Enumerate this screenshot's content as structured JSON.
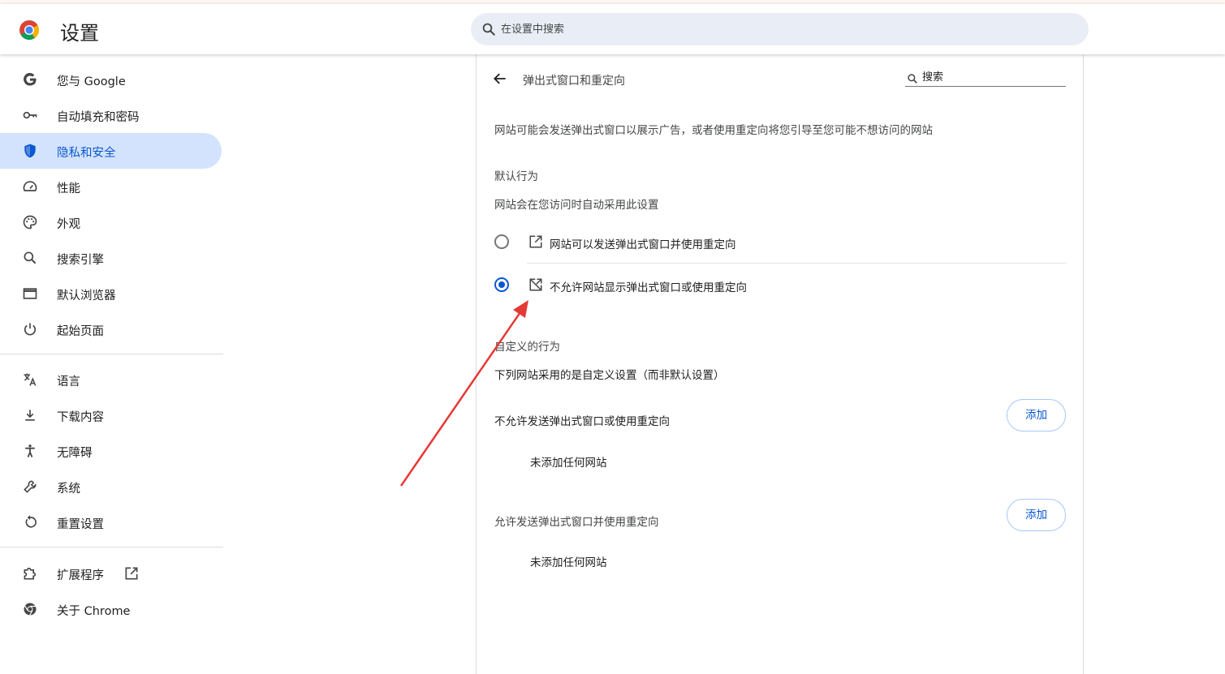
{
  "header": {
    "title": "设置",
    "search_placeholder": "在设置中搜索"
  },
  "sidebar": {
    "items": [
      {
        "label": "您与 Google",
        "icon": "google-icon"
      },
      {
        "label": "自动填充和密码",
        "icon": "key-icon"
      },
      {
        "label": "隐私和安全",
        "icon": "shield-icon",
        "active": true
      },
      {
        "label": "性能",
        "icon": "speedometer-icon"
      },
      {
        "label": "外观",
        "icon": "palette-icon"
      },
      {
        "label": "搜索引擎",
        "icon": "search-icon"
      },
      {
        "label": "默认浏览器",
        "icon": "browser-window-icon"
      },
      {
        "label": "起始页面",
        "icon": "power-icon"
      },
      {
        "label": "语言",
        "icon": "translate-icon"
      },
      {
        "label": "下载内容",
        "icon": "download-icon"
      },
      {
        "label": "无障碍",
        "icon": "accessibility-icon"
      },
      {
        "label": "系统",
        "icon": "wrench-icon"
      },
      {
        "label": "重置设置",
        "icon": "reset-icon"
      },
      {
        "label": "扩展程序",
        "icon": "puzzle-icon"
      },
      {
        "label": "关于 Chrome",
        "icon": "chrome-icon"
      }
    ]
  },
  "panel": {
    "title": "弹出式窗口和重定向",
    "search_placeholder": "搜索",
    "description": "网站可能会发送弹出式窗口以展示广告，或者使用重定向将您引导至您可能不想访问的网站",
    "default_behavior": {
      "heading": "默认行为",
      "subheading": "网站会在您访问时自动采用此设置",
      "options": [
        {
          "label": "网站可以发送弹出式窗口并使用重定向",
          "icon": "open-in-new-icon",
          "selected": false
        },
        {
          "label": "不允许网站显示弹出式窗口或使用重定向",
          "icon": "popup-blocked-icon",
          "selected": true
        }
      ]
    },
    "custom_behavior": {
      "heading": "自定义的行为",
      "subheading": "下列网站采用的是自定义设置（而非默认设置）",
      "sections": [
        {
          "title": "不允许发送弹出式窗口或使用重定向",
          "add_label": "添加",
          "empty_text": "未添加任何网站"
        },
        {
          "title": "允许发送弹出式窗口并使用重定向",
          "add_label": "添加",
          "empty_text": "未添加任何网站"
        }
      ]
    }
  },
  "colors": {
    "accent": "#0b57d0",
    "active_nav_bg": "#d3e3fd",
    "annotation_arrow": "#e53935"
  }
}
